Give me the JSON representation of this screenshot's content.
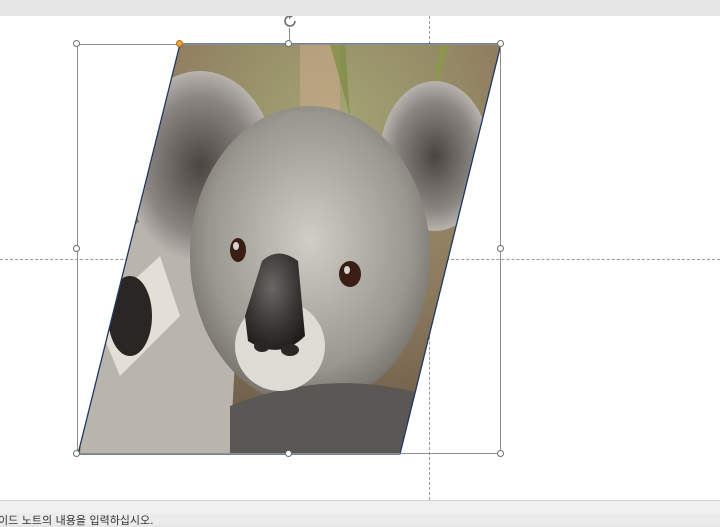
{
  "slide": {
    "picture": {
      "subject_icon": "koala-photo",
      "shape": "parallelogram",
      "outline_color": "#1f3864"
    },
    "selection": {
      "handle_color": "#ffffff",
      "adjust_handle_color": "#f3a533",
      "rotate_icon": "rotate-icon"
    }
  },
  "status_bar": {
    "notes_placeholder": "이드 노트의 내용을 입력하십시오."
  }
}
